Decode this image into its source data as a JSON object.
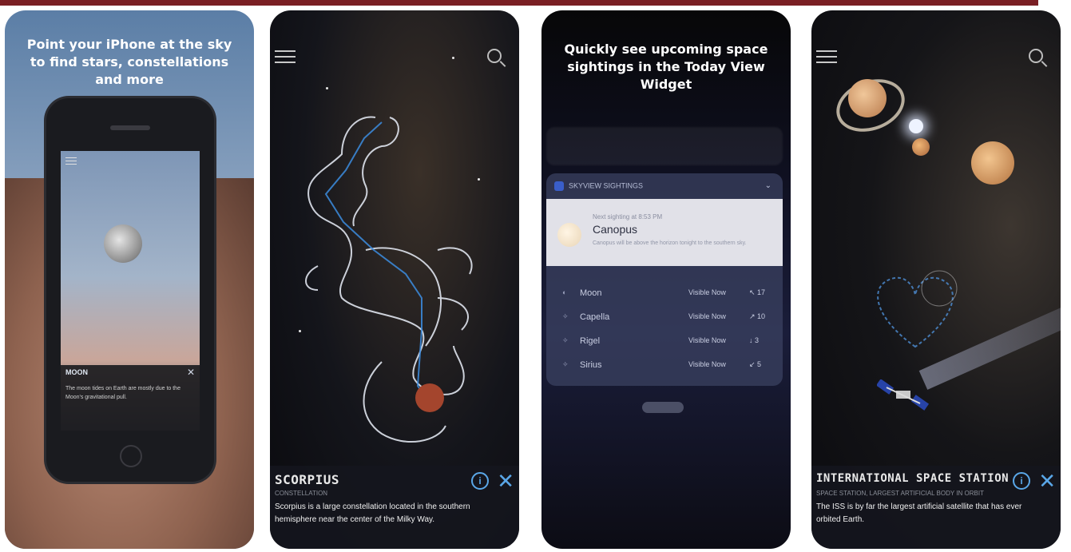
{
  "panels": [
    {
      "id": "panel-1",
      "caption": "Point your iPhone at the sky to find stars, constellations and more",
      "phone_screen": {
        "info_title": "MOON",
        "info_desc": "The moon tides on Earth are mostly due to the Moon's gravitational pull."
      }
    },
    {
      "id": "panel-2",
      "info": {
        "title": "SCORPIUS",
        "subtitle": "CONSTELLATION",
        "description": "Scorpius is a large constellation located in the southern hemisphere near the center of the Milky Way."
      }
    },
    {
      "id": "panel-3",
      "caption": "Quickly see upcoming space sightings in the Today View Widget",
      "widget": {
        "header": "SKYVIEW SIGHTINGS",
        "next_label": "Next sighting at 8:53 PM",
        "featured": "Canopus",
        "featured_desc": "Canopus will be above the horizon tonight to the southern sky.",
        "rows": [
          {
            "name": "Moon",
            "visibility": "Visible Now",
            "dir": "↖ 17"
          },
          {
            "name": "Capella",
            "visibility": "Visible Now",
            "dir": "↗ 10"
          },
          {
            "name": "Rigel",
            "visibility": "Visible Now",
            "dir": "↓ 3"
          },
          {
            "name": "Sirius",
            "visibility": "Visible Now",
            "dir": "↙ 5"
          }
        ]
      }
    },
    {
      "id": "panel-4",
      "info": {
        "title": "INTERNATIONAL SPACE STATION",
        "subtitle": "SPACE STATION, LARGEST ARTIFICIAL BODY IN ORBIT",
        "description": "The ISS is by far the largest artificial satellite that has ever orbited Earth."
      }
    }
  ],
  "colors": {
    "accent": "#5aa7e8",
    "top_bar": "#7a1f24"
  }
}
